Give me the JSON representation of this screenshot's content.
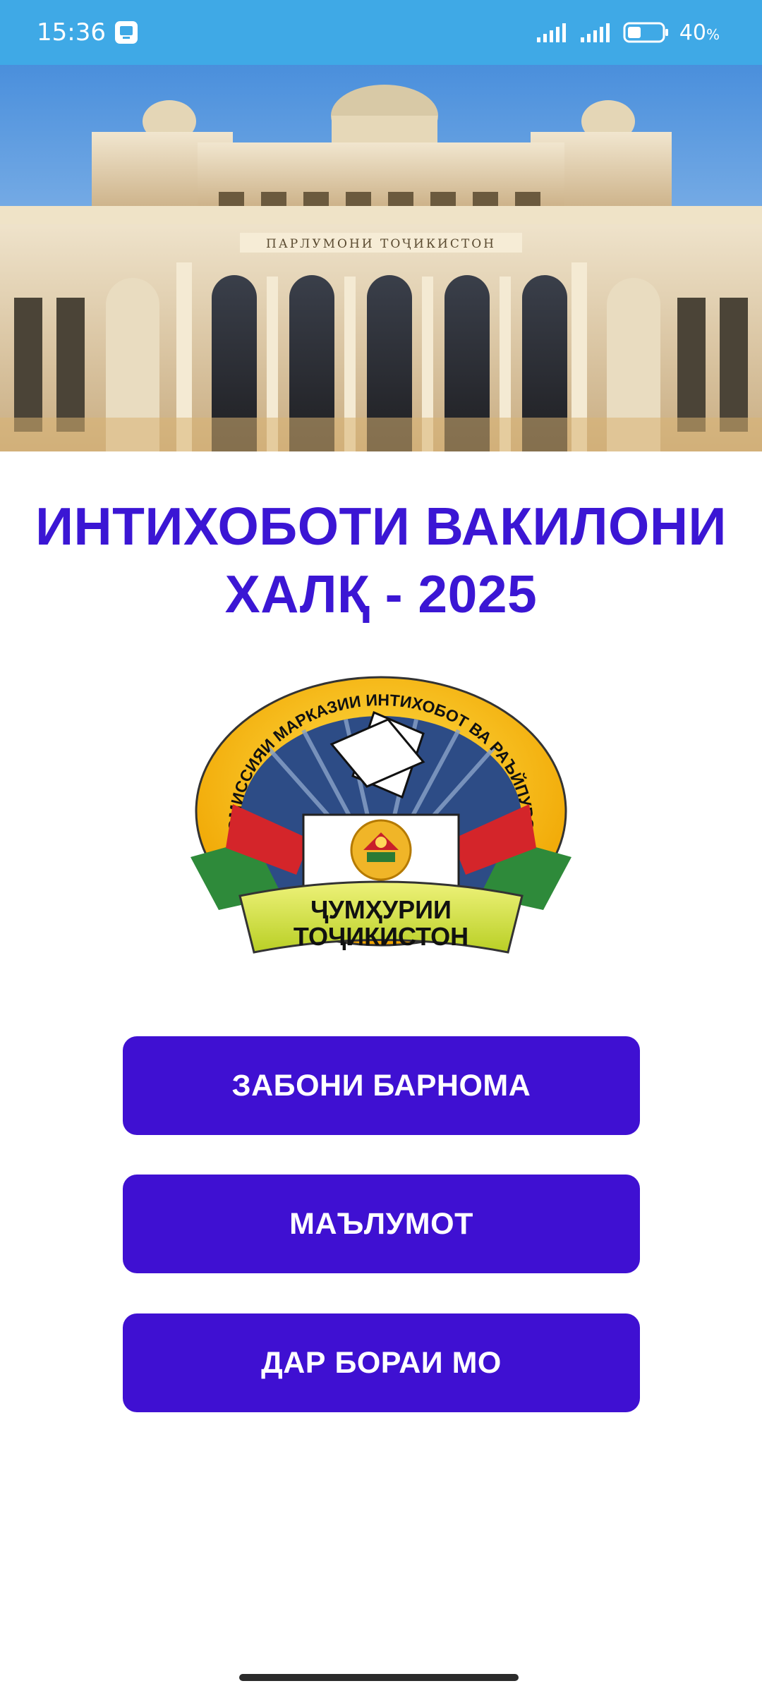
{
  "status_bar": {
    "time": "15:36",
    "battery_percent": "40",
    "battery_unit": "%",
    "battery_level": 0.4,
    "icons": [
      "notification-app-icon",
      "signal-icon",
      "signal-icon",
      "battery-icon"
    ]
  },
  "header": {
    "image": "parliament-building-photo",
    "building_inscription": "ПАРЛУМОНИ ТОҶИКИСТОН"
  },
  "title": {
    "line1": "ИНТИХОБОТИ ВАКИЛОНИ",
    "line2": "ХАЛҚ - 2025"
  },
  "emblem": {
    "ring_text": "КОМИССИЯИ МАРКАЗИИ ИНТИХОБОТ ВА РАЪЙПУРСӢ",
    "ribbon_line1": "ҶУМҲУРИИ",
    "ribbon_line2": "ТОҶИКИСТОН"
  },
  "menu": {
    "program_language": "ЗАБОНИ БАРНОМА",
    "information": "МАЪЛУМОТ",
    "about_us": "ДАР БОРАИ МО"
  },
  "colors": {
    "status_bar": "#3fa9e6",
    "accent": "#3b16d4",
    "button": "#3f10d2",
    "button_text": "#ffffff"
  }
}
